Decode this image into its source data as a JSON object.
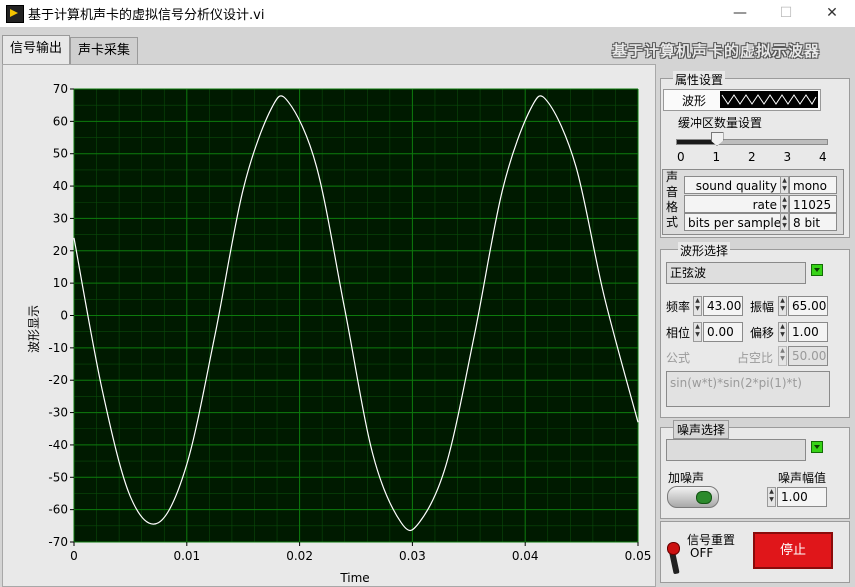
{
  "window": {
    "title": "基于计算机声卡的虚拟信号分析仪设计.vi",
    "minimize": "—",
    "maximize": "☐",
    "close": "✕"
  },
  "tabs": [
    {
      "label": "信号输出",
      "active": true
    },
    {
      "label": "声卡采集",
      "active": false
    }
  ],
  "header_title": "基于计算机声卡的虚拟示波器",
  "properties": {
    "group_label": "属性设置",
    "waveform_label": "波形",
    "buffer_label": "缓冲区数量设置",
    "buffer_value": 1,
    "buffer_ticks": [
      "0",
      "1",
      "2",
      "3",
      "4"
    ],
    "sound_format_label": [
      "声",
      "音",
      "格",
      "式"
    ],
    "sound_format_rows": [
      {
        "name": "sound quality",
        "value": "mono"
      },
      {
        "name": "rate",
        "value": "11025"
      },
      {
        "name": "bits per sample",
        "value": "8 bit"
      }
    ]
  },
  "waveform_select": {
    "group_label": "波形选择",
    "selected": "正弦波",
    "frequency_label": "频率",
    "frequency": "43.00",
    "amplitude_label": "振幅",
    "amplitude": "65.00",
    "phase_label": "相位",
    "phase": "0.00",
    "offset_label": "偏移",
    "offset": "1.00",
    "formula_label": "公式",
    "duty_label": "占空比",
    "duty": "50.00",
    "formula": "sin(w*t)*sin(2*pi(1)*t)"
  },
  "noise": {
    "group_label": "噪声选择",
    "selected": "",
    "add_noise_label": "加噪声",
    "amplitude_label": "噪声幅值",
    "amplitude": "1.00"
  },
  "controls": {
    "reset_label": "信号重置",
    "reset_state": "OFF",
    "stop_label": "停止"
  },
  "colors": {
    "plot_bg": "#001a00",
    "grid": "#0d7a0d",
    "trace": "#ffffff",
    "stop_button": "#e0161a",
    "noise_toggle": "#2c8a2c"
  },
  "chart_data": {
    "type": "line",
    "xlabel": "Time",
    "ylabel": "波形显示",
    "xlim": [
      0,
      0.05
    ],
    "ylim": [
      -70,
      70
    ],
    "x_ticks": [
      "0",
      "0.01",
      "0.02",
      "0.03",
      "0.04",
      "0.05"
    ],
    "y_ticks": [
      "70",
      "60",
      "50",
      "40",
      "30",
      "20",
      "10",
      "0",
      "-10",
      "-20",
      "-30",
      "-40",
      "-50",
      "-60",
      "-70"
    ],
    "grid": true,
    "series": [
      {
        "x": [
          0,
          0.0025,
          0.005,
          0.0075,
          0.01,
          0.0125,
          0.015,
          0.0175,
          0.019,
          0.0215,
          0.024,
          0.0265,
          0.029,
          0.0306,
          0.033,
          0.0355,
          0.038,
          0.0405,
          0.042,
          0.0445,
          0.047,
          0.05
        ],
        "y": [
          24,
          -23,
          -56,
          -64,
          -46,
          -6,
          39,
          64,
          66,
          46,
          2,
          -43,
          -64,
          -64,
          -46,
          -6,
          39,
          64,
          66,
          46,
          6,
          -33
        ]
      }
    ]
  }
}
